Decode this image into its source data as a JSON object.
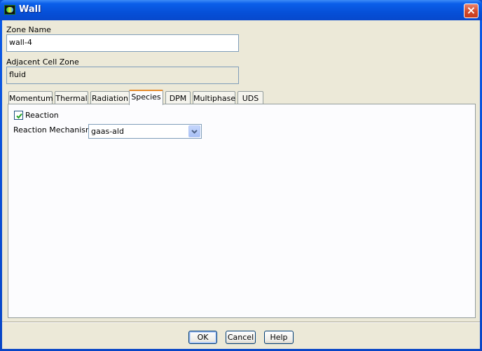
{
  "window": {
    "title": "Wall",
    "close_glyph": "×"
  },
  "zone_name": {
    "label": "Zone Name",
    "value": "wall-4"
  },
  "adjacent_cell_zone": {
    "label": "Adjacent Cell Zone",
    "value": "fluid"
  },
  "tabs": [
    {
      "label": "Momentum",
      "active": false
    },
    {
      "label": "Thermal",
      "active": false
    },
    {
      "label": "Radiation",
      "active": false
    },
    {
      "label": "Species",
      "active": true
    },
    {
      "label": "DPM",
      "active": false
    },
    {
      "label": "Multiphase",
      "active": false
    },
    {
      "label": "UDS",
      "active": false
    }
  ],
  "species_panel": {
    "reaction_label": "Reaction",
    "reaction_checked": true,
    "mechanisms_label": "Reaction Mechanisms",
    "mechanisms_value": "gaas-ald"
  },
  "buttons": {
    "ok": "OK",
    "cancel": "Cancel",
    "help": "Help"
  },
  "icons": {
    "app": "fluent-app-icon",
    "close": "close-icon",
    "check": "check-icon",
    "dropdown": "chevron-down-icon"
  },
  "colors": {
    "titlebar": "#0650d8",
    "dialog_bg": "#ece9d8",
    "panel_bg": "#fcfcfe",
    "active_tab_accent": "#e68b2c",
    "close_button": "#d14a2a",
    "checkmark": "#21a121"
  }
}
